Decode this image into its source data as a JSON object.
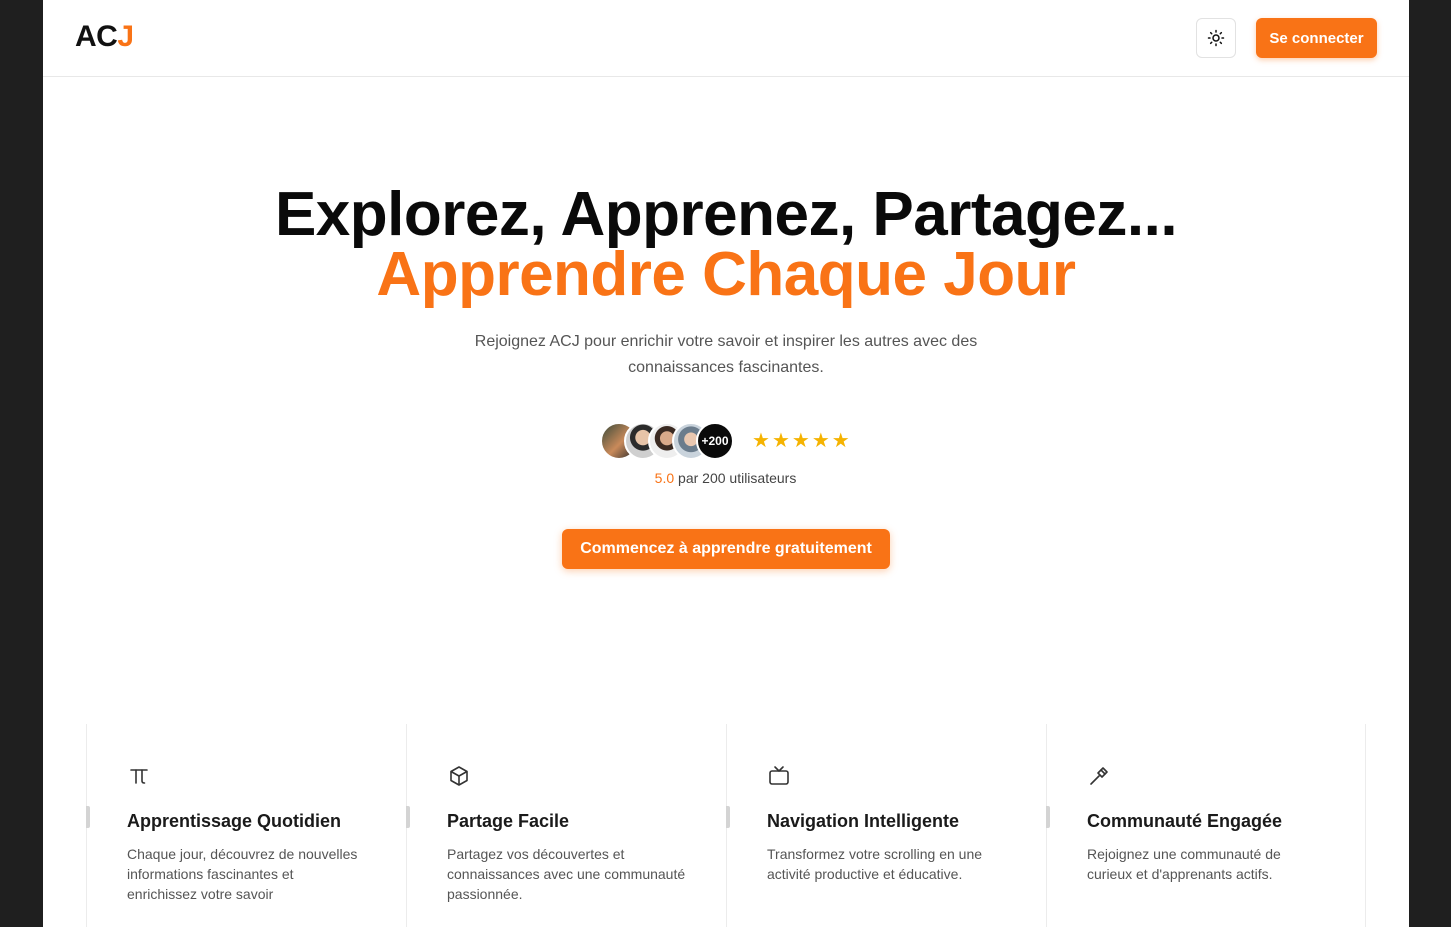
{
  "header": {
    "logo_main": "AC",
    "logo_accent": "J",
    "theme_toggle_icon": "sun-icon",
    "login_label": "Se connecter"
  },
  "hero": {
    "title_line1": "Explorez, Apprenez, Partagez...",
    "title_line2": "Apprendre Chaque Jour",
    "subtitle": "Rejoignez ACJ pour enrichir votre savoir et inspirer les autres avec des connaissances fascinantes.",
    "avatars_more": "+200",
    "stars": 5,
    "rating_score": "5.0",
    "rating_text": "par 200 utilisateurs",
    "cta_label": "Commencez à apprendre gratuitement"
  },
  "features": [
    {
      "icon": "pi-icon",
      "title": "Apprentissage Quotidien",
      "description": "Chaque jour, découvrez de nouvelles informations fascinantes et enrichissez votre savoir"
    },
    {
      "icon": "box-icon",
      "title": "Partage Facile",
      "description": "Partagez vos découvertes et connaissances avec une communauté passionnée."
    },
    {
      "icon": "tv-icon",
      "title": "Navigation Intelligente",
      "description": "Transformez votre scrolling en une activité productive et éducative."
    },
    {
      "icon": "hammer-icon",
      "title": "Communauté Engagée",
      "description": "Rejoignez une communauté de curieux et d'apprenants actifs."
    }
  ],
  "colors": {
    "accent": "#f97316",
    "star": "#f5b301",
    "backdrop": "#1f1f1f"
  }
}
